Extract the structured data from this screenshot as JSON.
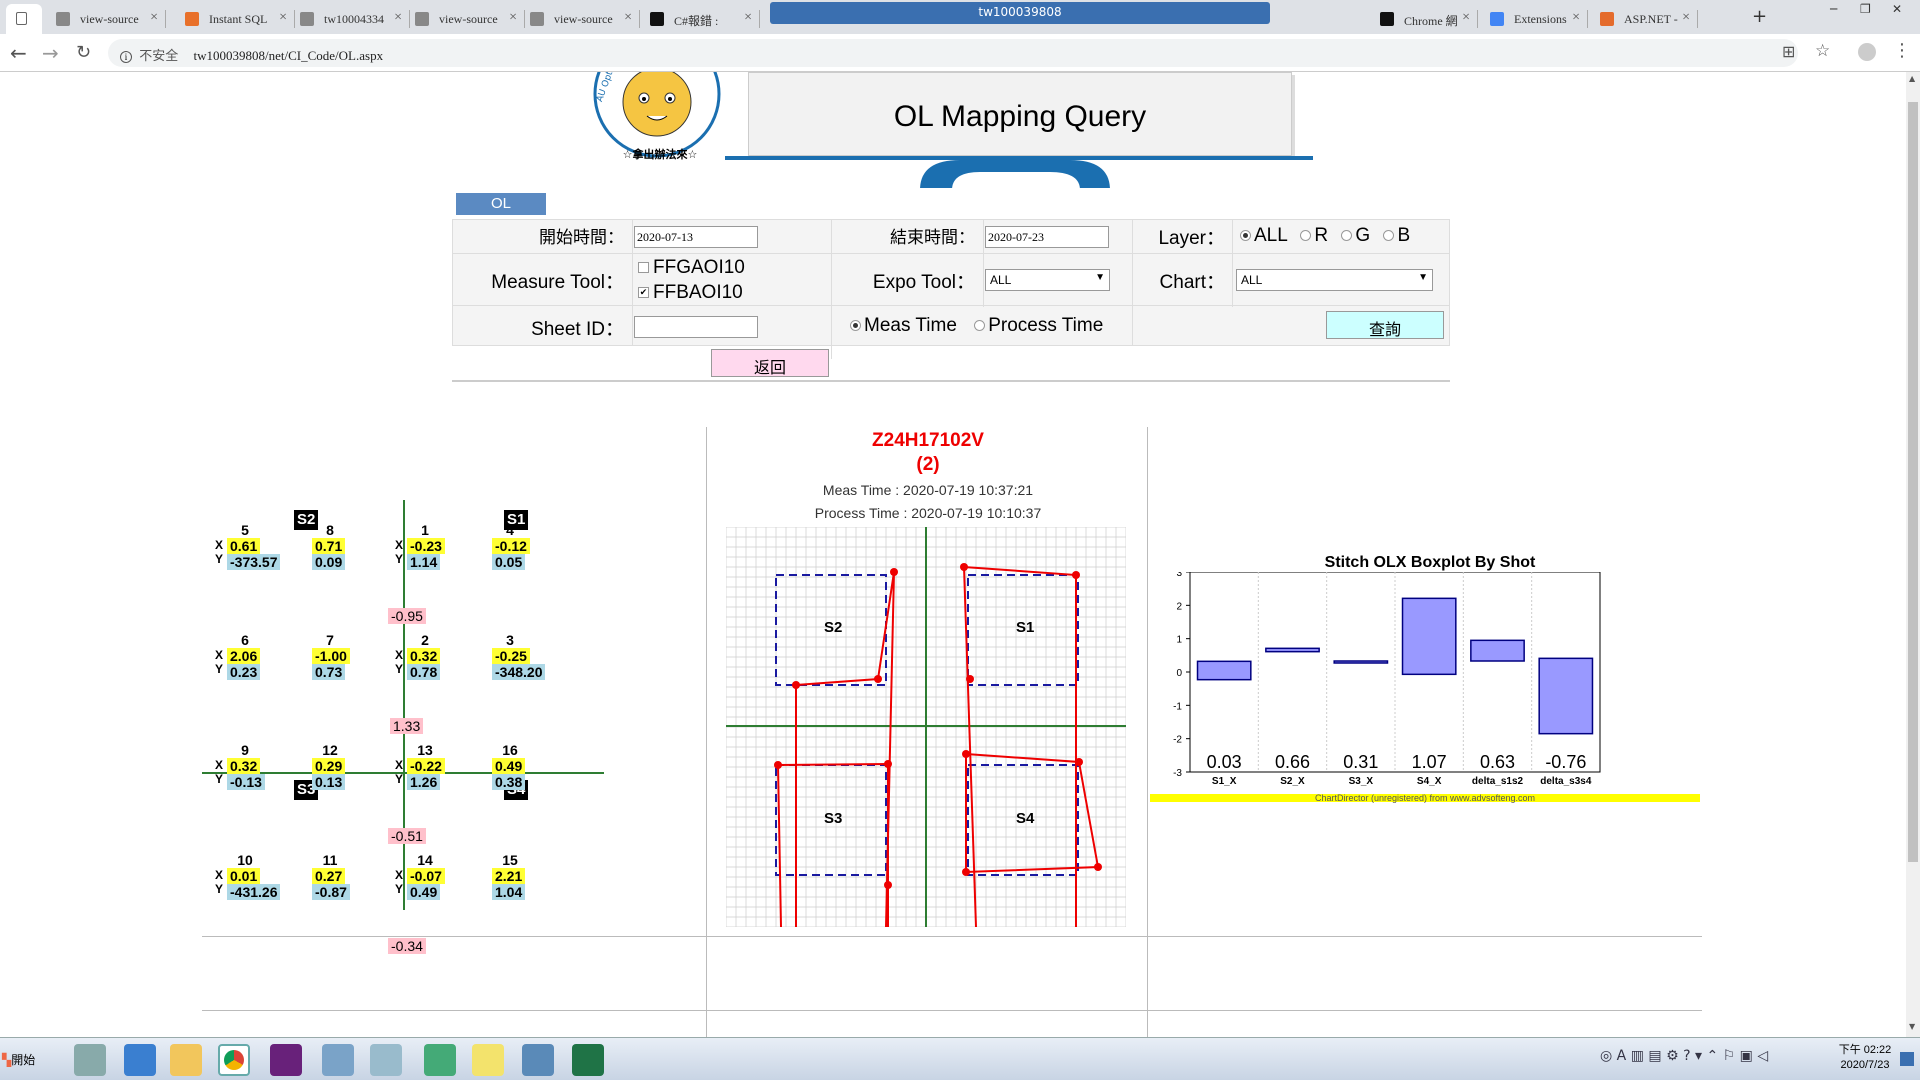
{
  "browser": {
    "tabs": [
      {
        "label": "view-source",
        "color": "#888"
      },
      {
        "label": "Instant SQL",
        "color": "#e8702a"
      },
      {
        "label": "tw10004334",
        "color": "#888"
      },
      {
        "label": "view-source",
        "color": "#888"
      },
      {
        "label": "view-source",
        "color": "#888"
      },
      {
        "label": "C#報錯 :",
        "color": "#111"
      },
      {
        "label": "Chrome 網",
        "color": "#111"
      },
      {
        "label": "Extensions",
        "color": "#4285f4"
      },
      {
        "label": "ASP.NET -",
        "color": "#e46b2c"
      }
    ],
    "active_tab_label": "",
    "window_title": "tw100039808",
    "insecure_label": "不安全",
    "url": "tw100039808/net/CI_Code/OL.aspx",
    "new_tab": "+"
  },
  "header": {
    "title": "OL Mapping Query",
    "logo_text": "AU Optronics Corp. Manufacturing",
    "logo_slogan": "☆拿出辦法來☆"
  },
  "form": {
    "tab_label": "OL",
    "start_label": "開始時間：",
    "start_value": "2020-07-13",
    "end_label": "結束時間：",
    "end_value": "2020-07-23",
    "layer_label": "Layer：",
    "layer_options": [
      "ALL",
      "R",
      "G",
      "B"
    ],
    "measure_tool_label": "Measure Tool：",
    "measure_tools": [
      {
        "label": "FFGAOI10",
        "checked": false
      },
      {
        "label": "FFBAOI10",
        "checked": true
      }
    ],
    "expo_tool_label": "Expo Tool：",
    "expo_tool_value": "ALL",
    "chart_label": "Chart：",
    "chart_value": "ALL",
    "sheet_id_label": "Sheet ID：",
    "sheet_id_value": "",
    "time_options": [
      "Meas Time",
      "Process Time"
    ],
    "query_button": "查詢",
    "back_button": "返回"
  },
  "mapping": {
    "shot_badges": [
      "S2",
      "S1",
      "S3",
      "S4"
    ],
    "cells": [
      {
        "num": "5",
        "x": "0.61",
        "y": "-373.57"
      },
      {
        "num": "8",
        "x": "0.71",
        "y": "0.09"
      },
      {
        "num": "1",
        "x": "-0.23",
        "y": "1.14"
      },
      {
        "num": "4",
        "x": "-0.12",
        "y": "0.05"
      },
      {
        "num": "6",
        "x": "2.06",
        "y": "0.23"
      },
      {
        "num": "7",
        "x": "-1.00",
        "y": "0.73"
      },
      {
        "num": "2",
        "x": "0.32",
        "y": "0.78"
      },
      {
        "num": "3",
        "x": "-0.25",
        "y": "-348.20"
      },
      {
        "num": "9",
        "x": "0.32",
        "y": "-0.13"
      },
      {
        "num": "12",
        "x": "0.29",
        "y": "0.13"
      },
      {
        "num": "13",
        "x": "-0.22",
        "y": "1.26"
      },
      {
        "num": "16",
        "x": "0.49",
        "y": "0.38"
      },
      {
        "num": "10",
        "x": "0.01",
        "y": "-431.26"
      },
      {
        "num": "11",
        "x": "0.27",
        "y": "-0.87"
      },
      {
        "num": "14",
        "x": "-0.07",
        "y": "0.49"
      },
      {
        "num": "15",
        "x": "2.21",
        "y": "1.04"
      }
    ],
    "deltas": [
      "-0.95",
      "1.33",
      "-0.51",
      "-0.34"
    ],
    "x_label": "X",
    "y_label": "Y"
  },
  "sheet": {
    "id": "Z24H17102V",
    "index": "(2)",
    "meas_time": "Meas Time : 2020-07-19 10:37:21",
    "process_time": "Process Time : 2020-07-19 10:10:37",
    "shot_labels": [
      "S2",
      "S1",
      "S3",
      "S4"
    ]
  },
  "chart_data": {
    "type": "box",
    "title": "Stitch OLX Boxplot By Shot",
    "categories": [
      "S1_X",
      "S2_X",
      "S3_X",
      "S4_X",
      "delta_s1s2",
      "delta_s3s4"
    ],
    "boxes": [
      {
        "low": -0.23,
        "high": 0.32
      },
      {
        "low": 0.61,
        "high": 0.71
      },
      {
        "low": 0.29,
        "high": 0.33
      },
      {
        "low": -0.07,
        "high": 2.21
      },
      {
        "low": 0.33,
        "high": 0.95
      },
      {
        "low": -1.85,
        "high": 0.41
      }
    ],
    "labels": [
      "0.03",
      "0.66",
      "0.31",
      "1.07",
      "0.63",
      "-0.76"
    ],
    "ylim": [
      -3,
      3
    ],
    "yticks": [
      3,
      2,
      1,
      0,
      -1,
      -2,
      -3
    ],
    "box_color": "#9999ff",
    "footer": "ChartDirector (unregistered) from www.advsofteng.com"
  },
  "taskbar": {
    "start_label": "開始",
    "clock_time": "下午 02:22",
    "clock_date": "2020/7/23"
  }
}
